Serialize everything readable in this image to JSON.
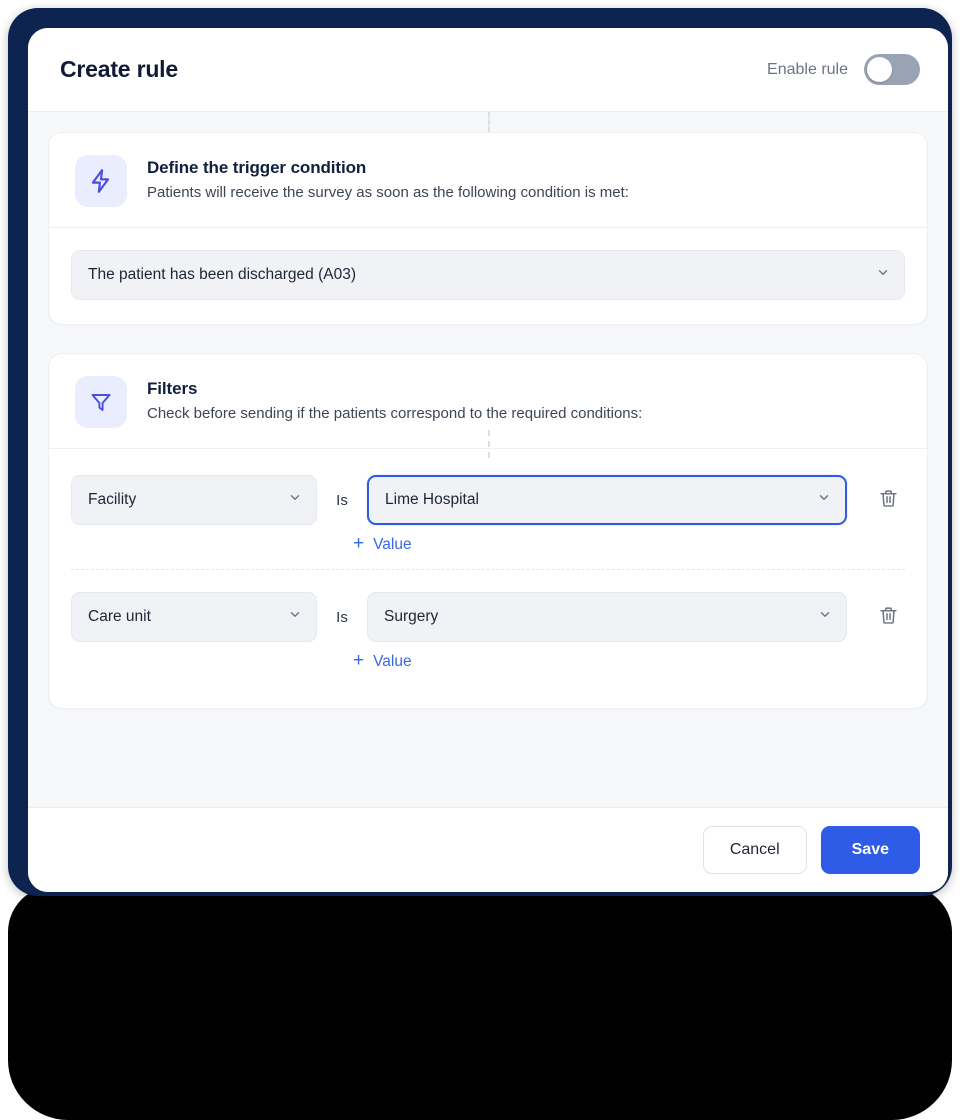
{
  "header": {
    "title": "Create rule",
    "enable_label": "Enable rule",
    "toggle_state": "off"
  },
  "sections": [
    {
      "icon": "lightning-bolt-icon",
      "title": "Define the trigger condition",
      "subtitle": "Patients will receive the survey as soon as the following condition is met:",
      "trigger_select": {
        "value": "The patient has been discharged (A03)",
        "chevron": "chevron-down-icon"
      }
    },
    {
      "icon": "filter-funnel-icon",
      "title": "Filters",
      "subtitle": "Check before sending if the patients correspond to the required conditions:"
    }
  ],
  "filters": {
    "operator_label": "Is",
    "add_value_label": "Value",
    "add_value_plus": "+",
    "delete_icon": "trash-icon",
    "rows": [
      {
        "key": "Facility",
        "value": "Lime Hospital",
        "focused": true
      },
      {
        "key": "Care unit",
        "value": "Surgery",
        "focused": false
      }
    ]
  },
  "footer": {
    "cancel_label": "Cancel",
    "save_label": "Save"
  },
  "colors": {
    "accent_blue": "#2f5ce6",
    "frame_navy": "#0d2350",
    "icon_indigo": "#4b4fe0",
    "icon_tile_bg": "#e9edfd",
    "field_bg": "#f1f2f6",
    "body_bg": "#f7f8fa"
  }
}
